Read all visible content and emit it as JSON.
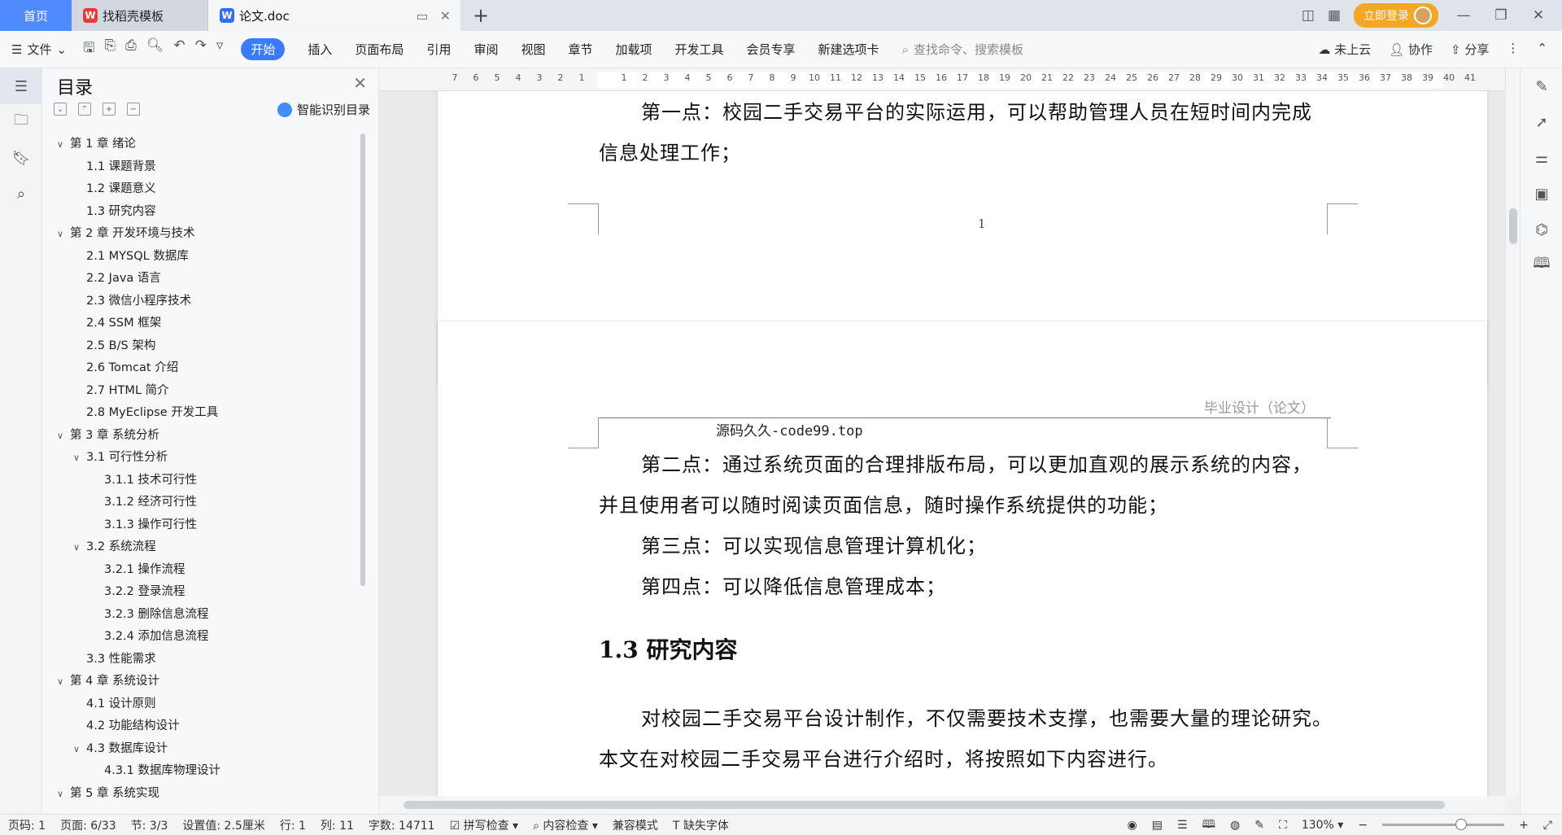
{
  "tabs": [
    {
      "label": "首页"
    },
    {
      "label": "找稻壳模板"
    },
    {
      "label": "论文.doc"
    }
  ],
  "titlebar": {
    "login": "立即登录"
  },
  "ribbon": {
    "file": "文件",
    "start": "开始",
    "items": [
      "插入",
      "页面布局",
      "引用",
      "审阅",
      "视图",
      "章节",
      "加载项",
      "开发工具",
      "会员专享",
      "新建选项卡"
    ],
    "search_placeholder": "查找命令、搜索模板",
    "right": [
      "未上云",
      "协作",
      "分享"
    ]
  },
  "toc": {
    "title": "目录",
    "smart": "智能识别目录",
    "items": [
      {
        "label": "第 1 章  绪论",
        "level": 1,
        "expanded": true
      },
      {
        "label": "1.1  课题背景",
        "level": 2
      },
      {
        "label": "1.2  课题意义",
        "level": 2
      },
      {
        "label": "1.3  研究内容",
        "level": 2
      },
      {
        "label": "第 2 章  开发环境与技术",
        "level": 1,
        "expanded": true
      },
      {
        "label": "2.1 MYSQL 数据库",
        "level": 2
      },
      {
        "label": "2.2 Java 语言",
        "level": 2
      },
      {
        "label": "2.3  微信小程序技术",
        "level": 2
      },
      {
        "label": "2.4 SSM 框架",
        "level": 2
      },
      {
        "label": "2.5 B/S 架构",
        "level": 2
      },
      {
        "label": "2.6 Tomcat  介绍",
        "level": 2
      },
      {
        "label": "2.7 HTML 简介",
        "level": 2
      },
      {
        "label": "2.8 MyEclipse 开发工具",
        "level": 2
      },
      {
        "label": "第 3 章  系统分析",
        "level": 1,
        "expanded": true
      },
      {
        "label": "3.1  可行性分析",
        "level": 2,
        "expanded": true
      },
      {
        "label": "3.1.1  技术可行性",
        "level": 3
      },
      {
        "label": "3.1.2  经济可行性",
        "level": 3
      },
      {
        "label": "3.1.3  操作可行性",
        "level": 3
      },
      {
        "label": "3.2  系统流程",
        "level": 2,
        "expanded": true
      },
      {
        "label": "3.2.1  操作流程",
        "level": 3
      },
      {
        "label": "3.2.2  登录流程",
        "level": 3
      },
      {
        "label": "3.2.3  删除信息流程",
        "level": 3
      },
      {
        "label": "3.2.4  添加信息流程",
        "level": 3
      },
      {
        "label": "3.3  性能需求",
        "level": 2
      },
      {
        "label": "第 4 章  系统设计",
        "level": 1,
        "expanded": true
      },
      {
        "label": "4.1  设计原则",
        "level": 2
      },
      {
        "label": "4.2  功能结构设计",
        "level": 2
      },
      {
        "label": "4.3  数据库设计",
        "level": 2,
        "expanded": true
      },
      {
        "label": "4.3.1  数据库物理设计",
        "level": 3
      },
      {
        "label": "第 5 章  系统实现",
        "level": 1,
        "expanded": true
      }
    ]
  },
  "ruler": {
    "numbers": [
      "7",
      "6",
      "5",
      "4",
      "3",
      "2",
      "1",
      "",
      "1",
      "2",
      "3",
      "4",
      "5",
      "6",
      "7",
      "8",
      "9",
      "10",
      "11",
      "12",
      "13",
      "14",
      "15",
      "16",
      "17",
      "18",
      "19",
      "20",
      "21",
      "22",
      "23",
      "24",
      "25",
      "26",
      "27",
      "28",
      "29",
      "30",
      "31",
      "32",
      "33",
      "34",
      "35",
      "36",
      "37",
      "38",
      "39",
      "40",
      "41"
    ]
  },
  "page1": {
    "line1": "第一点：校园二手交易平台的实际运用，可以帮助管理人员在短时间内完成",
    "line2": "信息处理工作；",
    "page_number": "1"
  },
  "page2": {
    "header_right": "毕业设计（论文）",
    "header_left": "源码久久-code99.top",
    "p1a": "第二点：通过系统页面的合理排版布局，可以更加直观的展示系统的内容，",
    "p1b": "并且使用者可以随时阅读页面信息，随时操作系统提供的功能；",
    "p2": "第三点：可以实现信息管理计算机化；",
    "p3": "第四点：可以降低信息管理成本；",
    "heading": "1.3  研究内容",
    "p4a": "对校园二手交易平台设计制作，不仅需要技术支撑，也需要大量的理论研究。",
    "p4b": "本文在对校园二手交易平台进行介绍时，将按照如下内容进行。"
  },
  "status": {
    "page_code": "页码: 1",
    "page": "页面: 6/33",
    "section": "节: 3/3",
    "setting": "设置值: 2.5厘米",
    "row": "行: 1",
    "col": "列: 11",
    "words": "字数: 14711",
    "spell": "拼写检查",
    "content": "内容检查",
    "compat": "兼容模式",
    "missing_font": "缺失字体",
    "zoom": "130%"
  }
}
